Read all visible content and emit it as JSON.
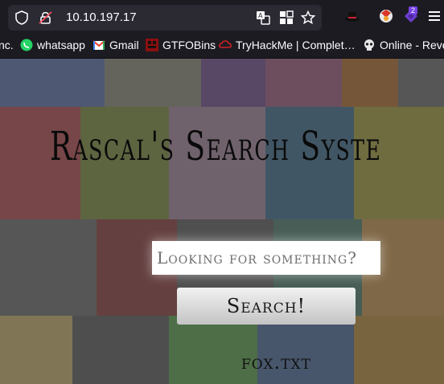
{
  "browser": {
    "url": "10.10.197.17",
    "extension_badge": "2"
  },
  "bookmarks": [
    {
      "label": "nc.",
      "icon": "truncated-bookmark"
    },
    {
      "label": "whatsapp",
      "icon": "whatsapp-icon"
    },
    {
      "label": "Gmail",
      "icon": "gmail-icon"
    },
    {
      "label": "GTFOBins",
      "icon": "gtfobins-icon"
    },
    {
      "label": "TryHackMe | Complet…",
      "icon": "tryhackme-icon"
    },
    {
      "label": "Online - Rever",
      "icon": "skull-icon"
    }
  ],
  "page": {
    "title": "Rascal's Search Syste",
    "search_placeholder": "Looking for something?",
    "search_button": "Search!",
    "link": "fox.txt"
  },
  "colors": {
    "chrome_bg": "#1c1b22",
    "urlbox_bg": "#2b2a33",
    "title": "#0a0a0a",
    "button_top": "#f2f2f2",
    "button_bottom": "#c4c4c4"
  }
}
